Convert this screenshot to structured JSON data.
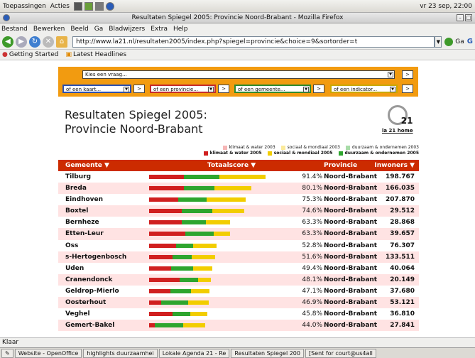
{
  "panel": {
    "apps": "Toepassingen",
    "actions": "Acties",
    "clock": "vr 23 sep, 22:00"
  },
  "window": {
    "title": "Resultaten Spiegel 2005: Provincie Noord-Brabant - Mozilla Firefox"
  },
  "menubar": [
    "Bestand",
    "Bewerken",
    "Beeld",
    "Ga",
    "Bladwijzers",
    "Extra",
    "Help"
  ],
  "nav": {
    "url": "http://www.la21.nl/resultaten2005/index.php?spiegel=provincie&choice=9&sortorder=t",
    "go": "Ga"
  },
  "bookmarks": [
    "Getting Started",
    "Latest Headlines"
  ],
  "page": {
    "question_placeholder": "Kies een vraag...",
    "selects": [
      "of een kaart...",
      "of een provincie...",
      "of een gemeente...",
      "of een indicator..."
    ],
    "go_label": ">",
    "title_line1": "Resultaten Spiegel 2005:",
    "title_line2": "Provincie Noord-Brabant",
    "logo_num": "21",
    "logo_link": "la 21 home"
  },
  "legend": {
    "row1": [
      "klimaat & water 2003",
      "sociaal & mondiaal 2003",
      "duurzaam & ondernemen 2003"
    ],
    "row2": [
      "klimaat & water 2005",
      "sociaal & mondiaal 2005",
      "duurzaam & ondernemen 2005"
    ]
  },
  "colors": {
    "red": "#d01f1f",
    "green": "#2ea52e",
    "yellow": "#f2cd00",
    "header": "#cc2b00"
  },
  "table": {
    "headers": [
      "Gemeente ▼",
      "Totaalscore ▼",
      "Provincie",
      "Inwoners ▼"
    ],
    "rows": [
      {
        "name": "Tilburg",
        "score": "91.4%",
        "prov": "Noord-Brabant",
        "inw": "198.767",
        "r": 0.3,
        "g": 0.3,
        "y": 0.4,
        "frac": 0.914
      },
      {
        "name": "Breda",
        "score": "80.1%",
        "prov": "Noord-Brabant",
        "inw": "166.035",
        "r": 0.34,
        "g": 0.3,
        "y": 0.36,
        "frac": 0.801
      },
      {
        "name": "Eindhoven",
        "score": "75.3%",
        "prov": "Noord-Brabant",
        "inw": "207.870",
        "r": 0.3,
        "g": 0.3,
        "y": 0.4,
        "frac": 0.753
      },
      {
        "name": "Boxtel",
        "score": "74.6%",
        "prov": "Noord-Brabant",
        "inw": "29.512",
        "r": 0.34,
        "g": 0.32,
        "y": 0.34,
        "frac": 0.746
      },
      {
        "name": "Bernheze",
        "score": "63.3%",
        "prov": "Noord-Brabant",
        "inw": "28.868",
        "r": 0.4,
        "g": 0.3,
        "y": 0.3,
        "frac": 0.633
      },
      {
        "name": "Etten-Leur",
        "score": "63.3%",
        "prov": "Noord-Brabant",
        "inw": "39.657",
        "r": 0.45,
        "g": 0.35,
        "y": 0.2,
        "frac": 0.633
      },
      {
        "name": "Oss",
        "score": "52.8%",
        "prov": "Noord-Brabant",
        "inw": "76.307",
        "r": 0.4,
        "g": 0.25,
        "y": 0.35,
        "frac": 0.528
      },
      {
        "name": "s-Hertogenbosch",
        "score": "51.6%",
        "prov": "Noord-Brabant",
        "inw": "133.511",
        "r": 0.35,
        "g": 0.3,
        "y": 0.35,
        "frac": 0.516
      },
      {
        "name": "Uden",
        "score": "49.4%",
        "prov": "Noord-Brabant",
        "inw": "40.064",
        "r": 0.35,
        "g": 0.35,
        "y": 0.3,
        "frac": 0.494
      },
      {
        "name": "Cranendonck",
        "score": "48.1%",
        "prov": "Noord-Brabant",
        "inw": "20.149",
        "r": 0.5,
        "g": 0.3,
        "y": 0.2,
        "frac": 0.481
      },
      {
        "name": "Geldrop-Mierlo",
        "score": "47.1%",
        "prov": "Noord-Brabant",
        "inw": "37.680",
        "r": 0.35,
        "g": 0.35,
        "y": 0.3,
        "frac": 0.471
      },
      {
        "name": "Oosterhout",
        "score": "46.9%",
        "prov": "Noord-Brabant",
        "inw": "53.121",
        "r": 0.2,
        "g": 0.45,
        "y": 0.35,
        "frac": 0.469
      },
      {
        "name": "Veghel",
        "score": "45.8%",
        "prov": "Noord-Brabant",
        "inw": "36.810",
        "r": 0.4,
        "g": 0.3,
        "y": 0.3,
        "frac": 0.458
      },
      {
        "name": "Gemert-Bakel",
        "score": "44.0%",
        "prov": "Noord-Brabant",
        "inw": "27.841",
        "r": 0.1,
        "g": 0.5,
        "y": 0.4,
        "frac": 0.44
      }
    ]
  },
  "status": "Klaar",
  "taskbar": [
    "Website - OpenOffice",
    "highlights duurzaamhei",
    "Lokale Agenda 21 - Re",
    "Resultaten Spiegel 200",
    "[Sent for court@us4all"
  ]
}
